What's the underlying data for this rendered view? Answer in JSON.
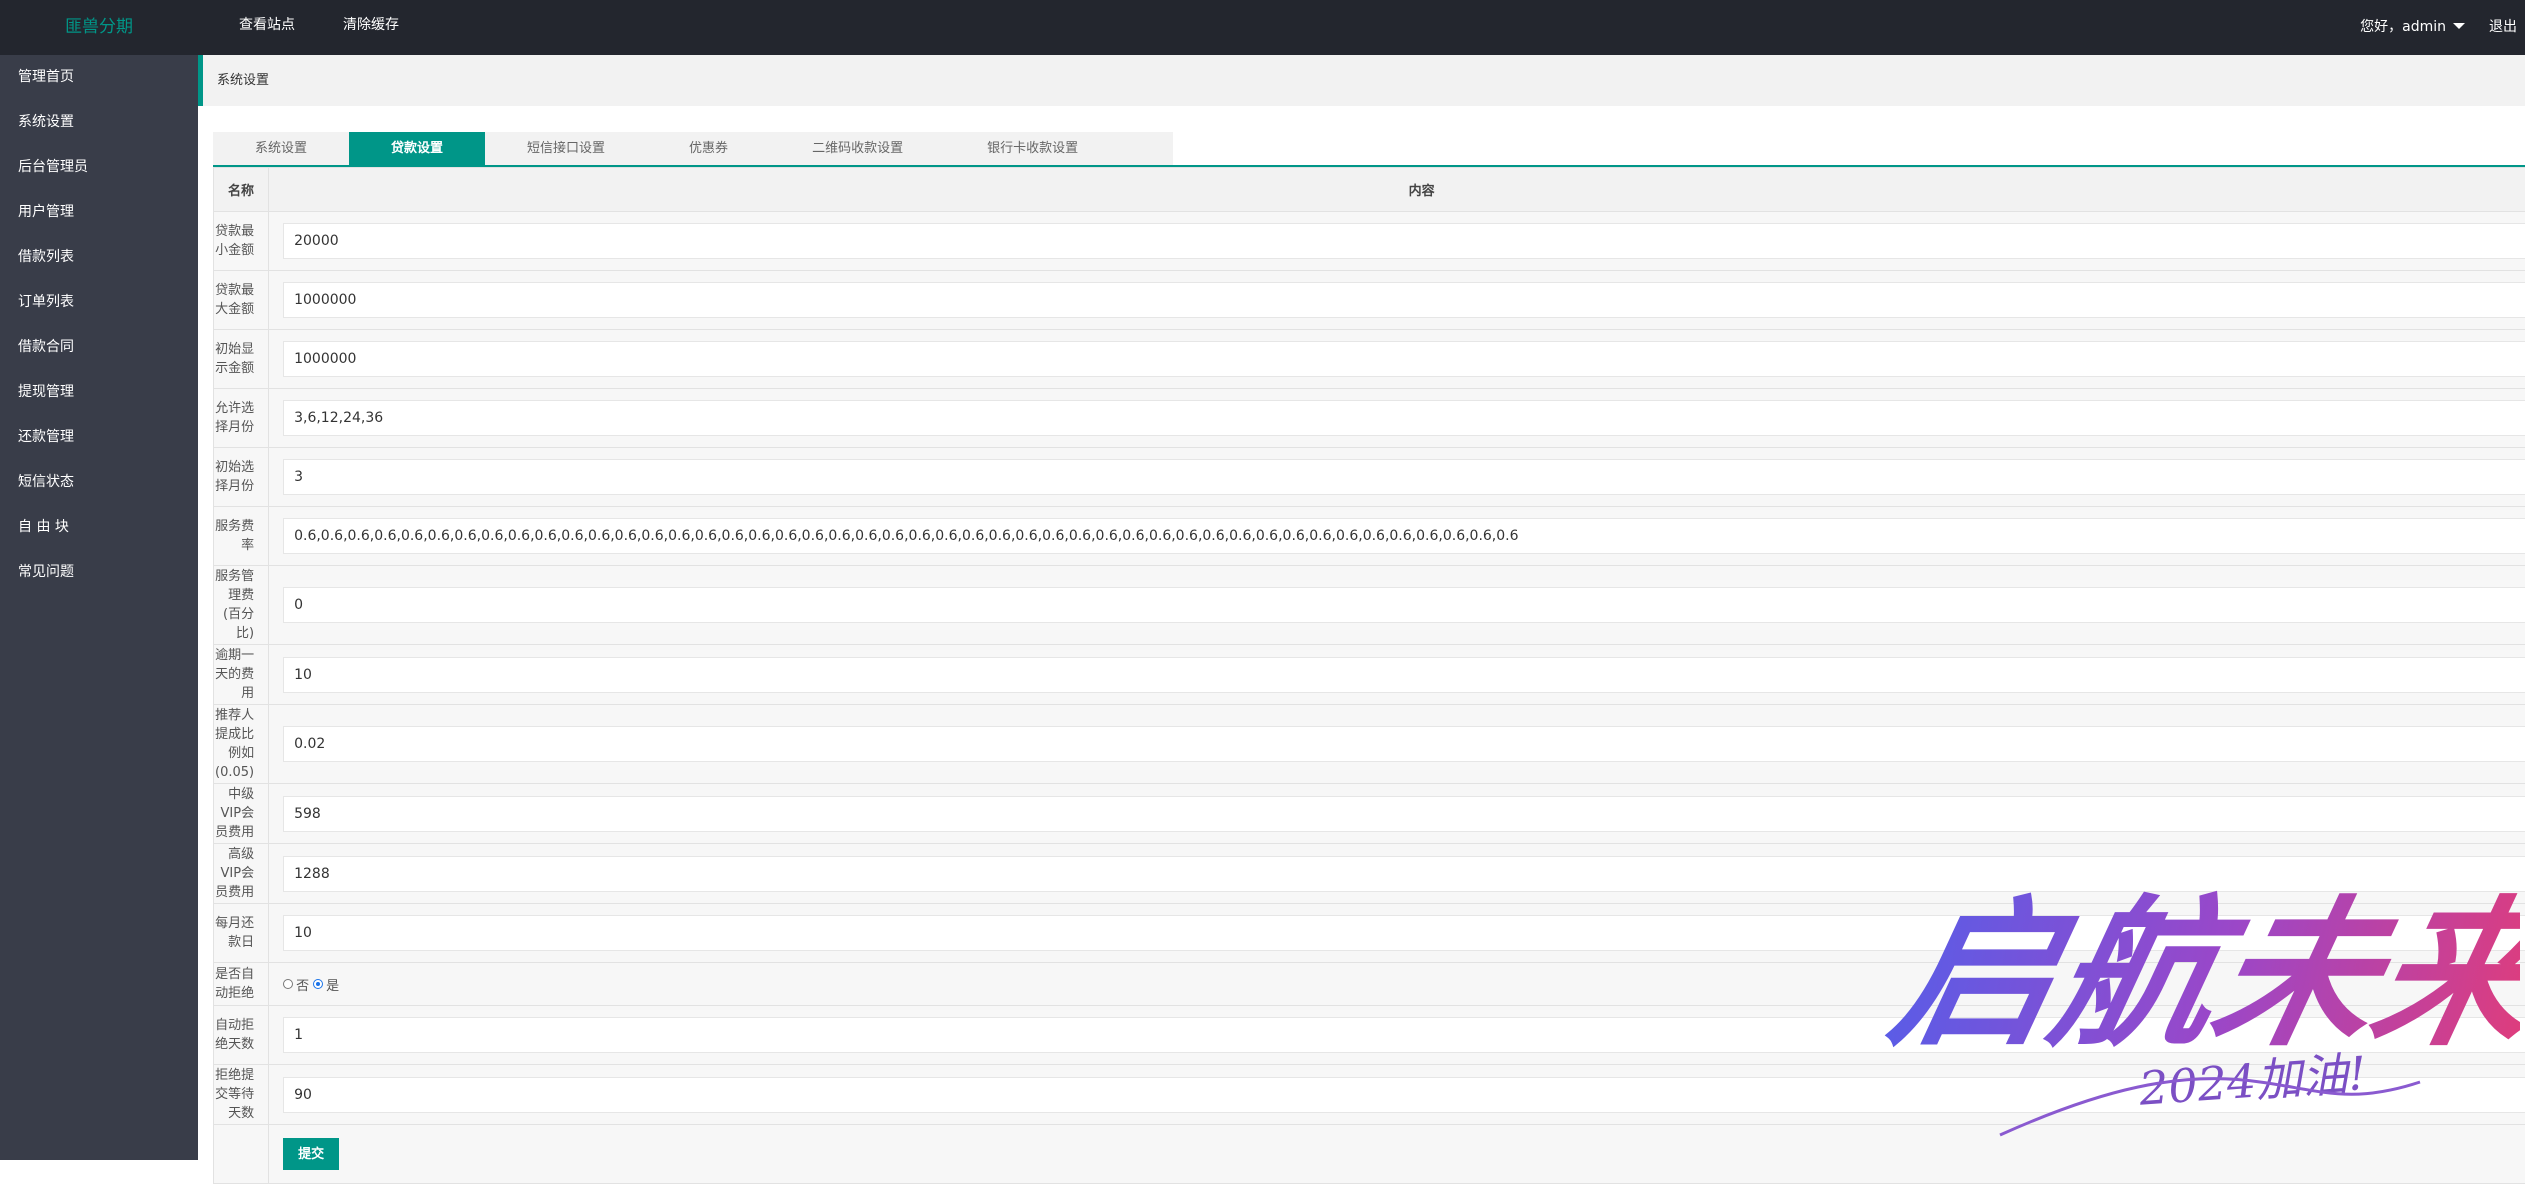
{
  "header": {
    "logo": "匪兽分期",
    "nav": [
      "查看站点",
      "清除缓存"
    ],
    "greeting": "您好，admin",
    "logout": "退出"
  },
  "sidebar": {
    "items": [
      {
        "label": "管理首页"
      },
      {
        "label": "系统设置"
      },
      {
        "label": "后台管理员"
      },
      {
        "label": "用户管理"
      },
      {
        "label": "借款列表"
      },
      {
        "label": "订单列表"
      },
      {
        "label": "借款合同"
      },
      {
        "label": "提现管理"
      },
      {
        "label": "还款管理"
      },
      {
        "label": "短信状态"
      },
      {
        "label": "自 由 块"
      },
      {
        "label": "常见问题"
      }
    ]
  },
  "breadcrumb": "系统设置",
  "tabs": [
    {
      "label": "系统设置"
    },
    {
      "label": "贷款设置"
    },
    {
      "label": "短信接口设置"
    },
    {
      "label": "优惠券"
    },
    {
      "label": "二维码收款设置"
    },
    {
      "label": "银行卡收款设置"
    }
  ],
  "active_tab": 1,
  "table": {
    "col_name": "名称",
    "col_content": "内容",
    "rows": [
      {
        "label": "贷款最小金额",
        "value": "20000"
      },
      {
        "label": "贷款最大金额",
        "value": "1000000"
      },
      {
        "label": "初始显示金额",
        "value": "1000000"
      },
      {
        "label": "允许选择月份",
        "value": "3,6,12,24,36"
      },
      {
        "label": "初始选择月份",
        "value": "3"
      },
      {
        "label": "服务费率",
        "value": "0.6,0.6,0.6,0.6,0.6,0.6,0.6,0.6,0.6,0.6,0.6,0.6,0.6,0.6,0.6,0.6,0.6,0.6,0.6,0.6,0.6,0.6,0.6,0.6,0.6,0.6,0.6,0.6,0.6,0.6,0.6,0.6,0.6,0.6,0.6,0.6,0.6,0.6,0.6,0.6,0.6,0.6,0.6,0.6,0.6,0.6"
      },
      {
        "label": "服务管理费(百分比)",
        "value": "0"
      },
      {
        "label": "逾期一天的费用",
        "value": "10"
      },
      {
        "label": "推荐人提成比例如(0.05)",
        "label_line1": "推荐人提成比例如",
        "label_line2": "(0.05)",
        "value": "0.02"
      },
      {
        "label": "中级VIP会员费用",
        "value": "598"
      },
      {
        "label": "高级VIP会员费用",
        "value": "1288"
      },
      {
        "label": "每月还款日",
        "value": "10"
      }
    ],
    "auto_reject": {
      "label": "是否自动拒绝",
      "option_no": "否",
      "option_yes": "是",
      "selected": "是"
    },
    "rows_after": [
      {
        "label": "自动拒绝天数",
        "value": "1"
      },
      {
        "label": "拒绝提交等待天数",
        "value": "90"
      }
    ],
    "submit": "提交"
  },
  "watermark": {
    "main": "启航未来",
    "sub": "2024加油!"
  }
}
